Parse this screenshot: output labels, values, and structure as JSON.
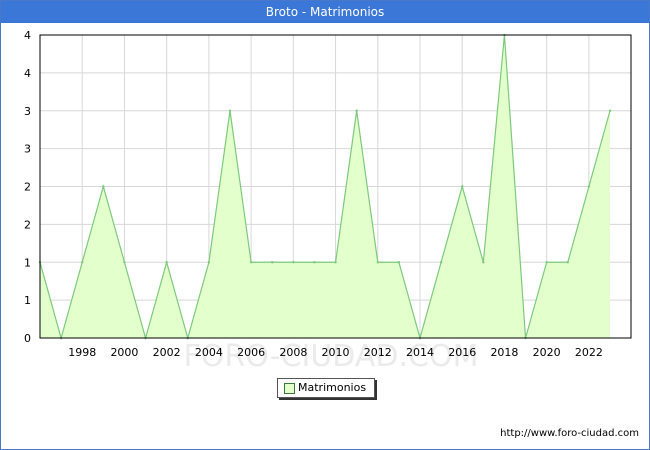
{
  "window": {
    "title": "Broto - Matrimonios"
  },
  "legend": {
    "label": "Matrimonios"
  },
  "footer": {
    "source": "http://www.foro-ciudad.com"
  },
  "watermark": "FORO-CIUDAD.COM",
  "colors": {
    "title_bar": "#3a77d6",
    "area_fill": "#e2ffcc",
    "line": "#7dc97d",
    "grid": "#d8d8d8"
  },
  "chart_data": {
    "type": "area",
    "title": "Broto - Matrimonios",
    "xlabel": "",
    "ylabel": "",
    "series": [
      {
        "name": "Matrimonios",
        "x": [
          1996,
          1997,
          1998,
          1999,
          2000,
          2001,
          2002,
          2003,
          2004,
          2005,
          2006,
          2007,
          2008,
          2009,
          2010,
          2011,
          2012,
          2013,
          2014,
          2015,
          2016,
          2017,
          2018,
          2019,
          2020,
          2021,
          2022,
          2023
        ],
        "values": [
          1,
          0,
          1,
          2,
          1,
          0,
          1,
          0,
          1,
          3,
          1,
          1,
          1,
          1,
          1,
          3,
          1,
          1,
          0,
          1,
          2,
          1,
          4,
          0,
          1,
          1,
          2,
          3
        ]
      }
    ],
    "x_ticks": [
      1998,
      2000,
      2002,
      2004,
      2006,
      2008,
      2010,
      2012,
      2014,
      2016,
      2018,
      2020,
      2022
    ],
    "y_ticks": [
      "0",
      "1",
      "1",
      "2",
      "2",
      "3",
      "3",
      "4",
      "4"
    ],
    "xlim": [
      1996,
      2023
    ],
    "ylim": [
      0,
      4
    ],
    "grid": true,
    "legend_position": "bottom-center"
  }
}
